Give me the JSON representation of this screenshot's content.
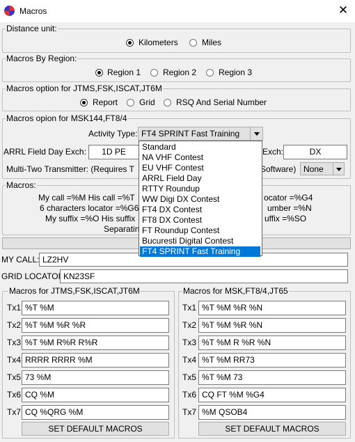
{
  "window": {
    "title": "Macros",
    "close": "✕"
  },
  "distance": {
    "label": "Distance unit:",
    "options": [
      "Kilometers",
      "Miles"
    ],
    "selected": "Kilometers"
  },
  "region": {
    "label": "Macros By Region:",
    "options": [
      "Region 1",
      "Region 2",
      "Region 3"
    ],
    "selected": "Region 1"
  },
  "jtms": {
    "label": "Macros option for JTMS,FSK,ISCAT,JT6M",
    "options": [
      "Report",
      "Grid",
      "RSQ And Serial Number"
    ],
    "selected": "Report"
  },
  "msk": {
    "label": "Macros opion for MSK144,FT8/4",
    "activity_label": "Activity Type:",
    "activity_value": "FT4 SPRINT Fast Training",
    "arrl_label": "ARRL Field Day Exch:",
    "arrl_value": "1D PE",
    "exch_label": "Exch:",
    "exch_value": "DX",
    "multi_label": "Multi-Two Transmitter: (Requires T",
    "software_label": "Software)",
    "multi_value": "None"
  },
  "dropdown": {
    "items": [
      "Standard",
      "NA VHF Contest",
      "EU VHF Contest",
      "ARRL Field Day",
      "RTTY Roundup",
      "WW Digi DX Contest",
      "FT4 DX Contest",
      "FT8 DX Contest",
      "FT Roundup Contest",
      "Bucuresti Digital Contest",
      "FT4 SPRINT Fast Training"
    ],
    "selected_index": 10
  },
  "macros_info": {
    "label": "Macros:",
    "line1_a": "My call =%M  His call =%T",
    "line1_b": "ocator =%G4",
    "line2_a": "6 characters locator =%G6",
    "line2_b": "umber =%N",
    "line3_a": "My suffix =%O  His suffix",
    "line3_b": "uffix =%SO",
    "line4": "Separatin"
  },
  "mycall": {
    "label": "MY CALL:",
    "value": "LZ2HV"
  },
  "grid": {
    "label": "GRID LOCATOR:",
    "value": "KN23SF"
  },
  "left_macros": {
    "label": "Macros for JTMS,FSK,ISCAT,JT6M",
    "rows": [
      {
        "tx": "Tx1",
        "value": "%T %M"
      },
      {
        "tx": "Tx2",
        "value": "%T %M %R %R"
      },
      {
        "tx": "Tx3",
        "value": "%T %M R%R R%R"
      },
      {
        "tx": "Tx4",
        "value": "RRRR RRRR %M"
      },
      {
        "tx": "Tx5",
        "value": "73 %M"
      },
      {
        "tx": "Tx6",
        "value": "CQ %M"
      },
      {
        "tx": "Tx7",
        "value": "CQ %QRG %M"
      }
    ],
    "default_button": "SET DEFAULT MACROS"
  },
  "right_macros": {
    "label": "Macros for MSK,FT8/4,JT65",
    "rows": [
      {
        "tx": "Tx1",
        "value": "%T %M %R %N"
      },
      {
        "tx": "Tx2",
        "value": "%T %M %R %N"
      },
      {
        "tx": "Tx3",
        "value": "%T %M R %R %N"
      },
      {
        "tx": "Tx4",
        "value": "%T %M RR73"
      },
      {
        "tx": "Tx5",
        "value": "%T %M 73"
      },
      {
        "tx": "Tx6",
        "value": "CQ FT %M %G4"
      },
      {
        "tx": "Tx7",
        "value": "%M QSOB4"
      }
    ],
    "default_button": "SET DEFAULT MACROS"
  }
}
